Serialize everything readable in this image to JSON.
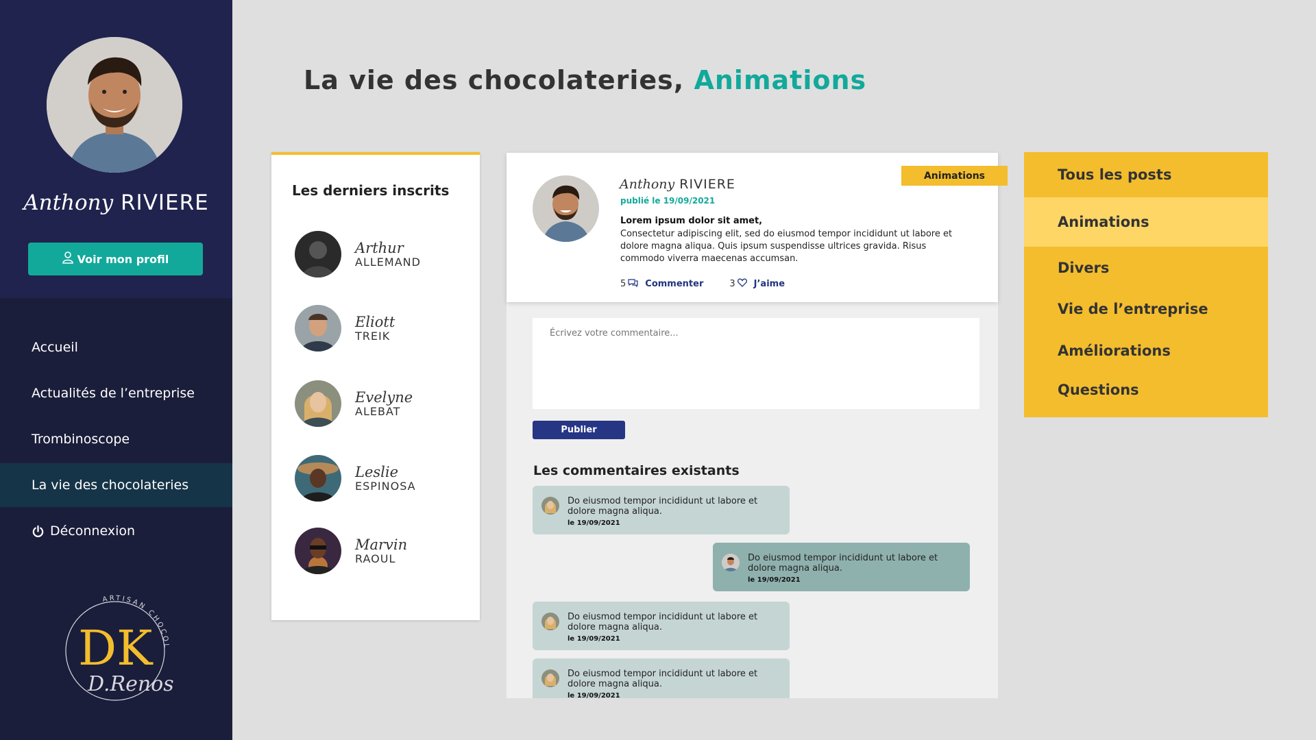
{
  "sidebar": {
    "user": {
      "first_name": "Anthony",
      "last_name": "RIVIERE"
    },
    "profile_button": "Voir mon profil",
    "nav": [
      {
        "label": "Accueil",
        "active": false
      },
      {
        "label": "Actualités de l’entreprise",
        "active": false
      },
      {
        "label": "Trombinoscope",
        "active": false
      },
      {
        "label": "La vie des chocolateries",
        "active": true
      },
      {
        "label": "Déconnexion",
        "active": false,
        "icon": "power-icon"
      }
    ],
    "logo": {
      "initials": "DK",
      "arc_text": "ARTISAN CHOCOLATIER",
      "signature": "D.Renos"
    }
  },
  "page_title": {
    "part1": "La vie",
    "part2": " des chocolateries, ",
    "accent": "Animations"
  },
  "members": {
    "title": "Les derniers inscrits",
    "items": [
      {
        "first": "Arthur",
        "last": "ALLEMAND"
      },
      {
        "first": "Eliott",
        "last": "TREIK"
      },
      {
        "first": "Evelyne",
        "last": "ALEBAT"
      },
      {
        "first": "Leslie",
        "last": "ESPINOSA"
      },
      {
        "first": "Marvin",
        "last": "RAOUL"
      }
    ]
  },
  "post": {
    "badge": "Animations",
    "author_first": "Anthony",
    "author_last": "RIVIERE",
    "date": "publié le 19/09/2021",
    "lead": "Lorem ipsum dolor sit amet,",
    "body": "Consectetur adipiscing elit, sed do eiusmod tempor incididunt ut labore et dolore magna aliqua. Quis ipsum suspendisse ultrices gravida. Risus commodo viverra maecenas accumsan.",
    "comments_count": "5",
    "comment_label": "Commenter",
    "likes_count": "3",
    "like_label": "J’aime"
  },
  "comment_form": {
    "placeholder": "Écrivez votre commentaire...",
    "publish_label": "Publier"
  },
  "comments": {
    "title": "Les commentaires existants",
    "items": [
      {
        "text": "Do eiusmod tempor incididunt ut labore et dolore magna aliqua.",
        "date": "le 19/09/2021",
        "mine": false
      },
      {
        "text": "Do eiusmod tempor incididunt ut labore et dolore magna aliqua.",
        "date": "le 19/09/2021",
        "mine": true
      },
      {
        "text": "Do eiusmod tempor incididunt ut labore et dolore magna aliqua.",
        "date": "le 19/09/2021",
        "mine": false
      },
      {
        "text": "Do eiusmod tempor incididunt ut labore et dolore magna aliqua.",
        "date": "le 19/09/2021",
        "mine": false
      }
    ]
  },
  "categories": [
    {
      "label": "Tous les posts",
      "active": false
    },
    {
      "label": "Animations",
      "active": true
    },
    {
      "label": "Divers",
      "active": false
    },
    {
      "label": "Vie de l’entreprise",
      "active": false
    },
    {
      "label": "Améliorations",
      "active": false
    },
    {
      "label": "Questions",
      "active": false
    }
  ],
  "colors": {
    "navy": "#20234d",
    "teal": "#12a99b",
    "yellow": "#f3bd2d",
    "yellow_active": "#fed666",
    "button_blue": "#273585"
  }
}
